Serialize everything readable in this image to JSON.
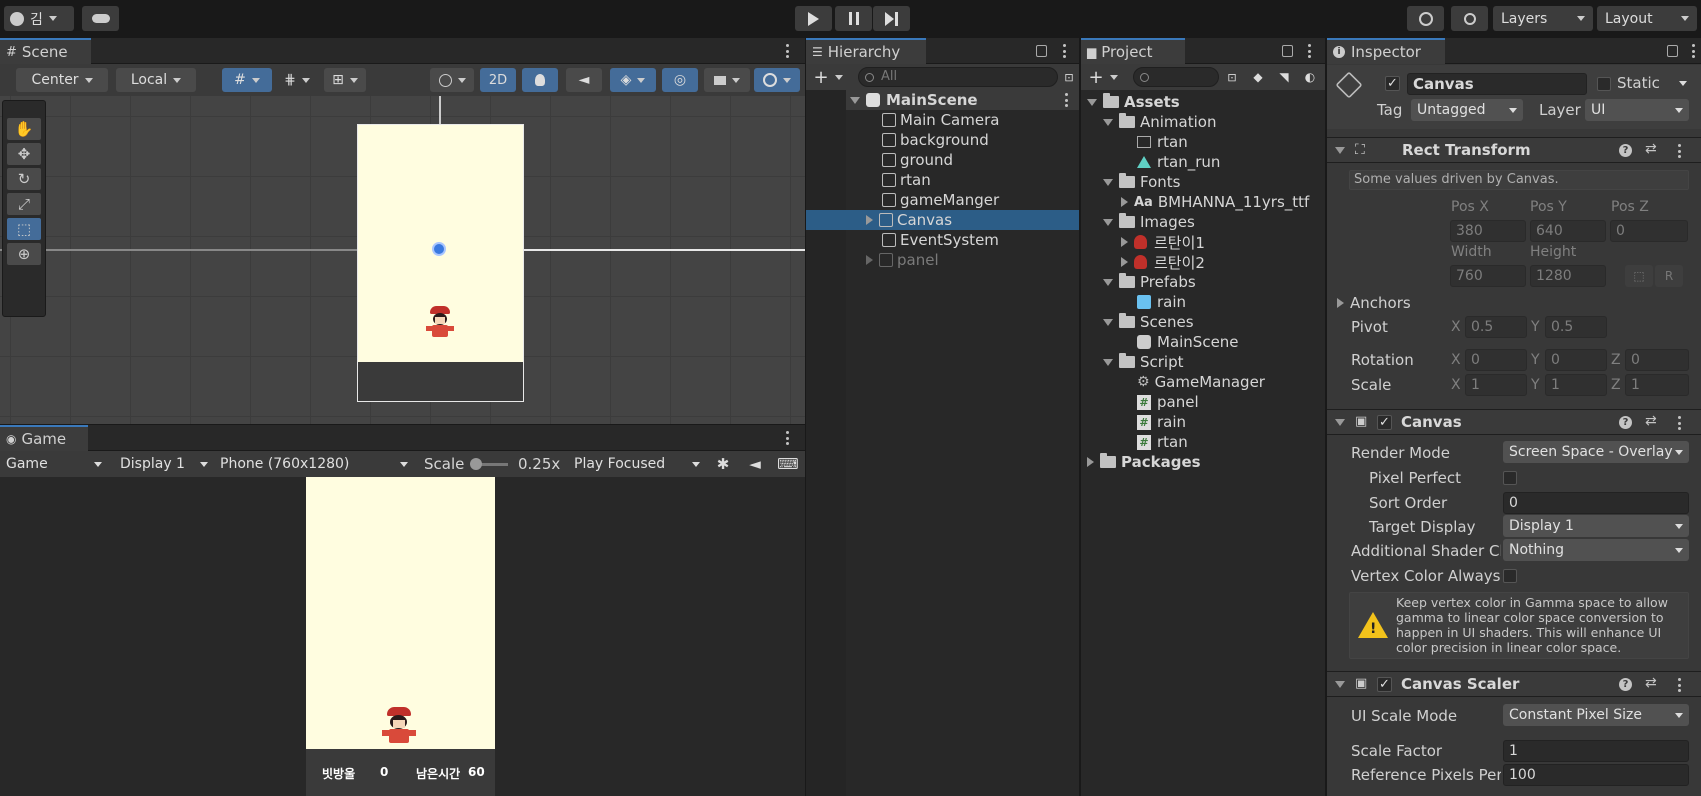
{
  "toolbar": {
    "account_label": "김",
    "layers_label": "Layers",
    "layout_label": "Layout"
  },
  "scene": {
    "tab": "Scene",
    "pivot_mode": "Center",
    "pivot_space": "Local",
    "mode_2d": "2D"
  },
  "game": {
    "tab": "Game",
    "game_dropdown": "Game",
    "display": "Display 1",
    "resolution": "Phone (760x1280)",
    "scale_label": "Scale",
    "scale_value": "0.25x",
    "play_mode": "Play Focused",
    "hud_score_label": "빗방울",
    "hud_score_value": "0",
    "hud_time_label": "남은시간",
    "hud_time_value": "60"
  },
  "hierarchy": {
    "tab": "Hierarchy",
    "search_placeholder": "All",
    "scene": "MainScene",
    "items": [
      "Main Camera",
      "background",
      "ground",
      "rtan",
      "gameManger",
      "Canvas",
      "EventSystem",
      "panel"
    ]
  },
  "project": {
    "tab": "Project",
    "tree": {
      "assets": "Assets",
      "animation": "Animation",
      "rtan_anim": "rtan",
      "rtan_run": "rtan_run",
      "fonts": "Fonts",
      "font_file": "BMHANNA_11yrs_ttf",
      "images": "Images",
      "img1": "르탄이1",
      "img2": "르탄이2",
      "prefabs": "Prefabs",
      "rain_prefab": "rain",
      "scenes": "Scenes",
      "mainscene": "MainScene",
      "script": "Script",
      "gamemanager": "GameManager",
      "panel_script": "panel",
      "rain_script": "rain",
      "rtan_script": "rtan",
      "packages": "Packages"
    }
  },
  "inspector": {
    "tab": "Inspector",
    "object_name": "Canvas",
    "static_label": "Static",
    "tag_label": "Tag",
    "tag_value": "Untagged",
    "layer_label": "Layer",
    "layer_value": "UI",
    "rect": {
      "title": "Rect Transform",
      "note": "Some values driven by Canvas.",
      "posx_label": "Pos X",
      "posy_label": "Pos Y",
      "posz_label": "Pos Z",
      "posx": "380",
      "posy": "640",
      "posz": "0",
      "width_label": "Width",
      "height_label": "Height",
      "width": "760",
      "height": "1280",
      "r_button": "R",
      "anchors": "Anchors",
      "pivot": "Pivot",
      "pivot_x": "0.5",
      "pivot_y": "0.5",
      "rotation": "Rotation",
      "rot_x": "0",
      "rot_y": "0",
      "rot_z": "0",
      "scale": "Scale",
      "scale_x": "1",
      "scale_y": "1",
      "scale_z": "1",
      "x": "X",
      "y": "Y",
      "z": "Z"
    },
    "canvas": {
      "title": "Canvas",
      "render_mode_label": "Render Mode",
      "render_mode": "Screen Space - Overlay",
      "pixel_perfect": "Pixel Perfect",
      "sort_order_label": "Sort Order",
      "sort_order": "0",
      "target_display_label": "Target Display",
      "target_display": "Display 1",
      "shader_label": "Additional Shader Ch",
      "shader_value": "Nothing",
      "vertex_label": "Vertex Color Always",
      "warning": "Keep vertex color in Gamma space to allow gamma to linear color space conversion to happen in UI shaders. This will enhance UI color precision in linear color space."
    },
    "scaler": {
      "title": "Canvas Scaler",
      "mode_label": "UI Scale Mode",
      "mode": "Constant Pixel Size",
      "factor_label": "Scale Factor",
      "factor": "1",
      "ref_label": "Reference Pixels Per",
      "ref": "100"
    }
  }
}
